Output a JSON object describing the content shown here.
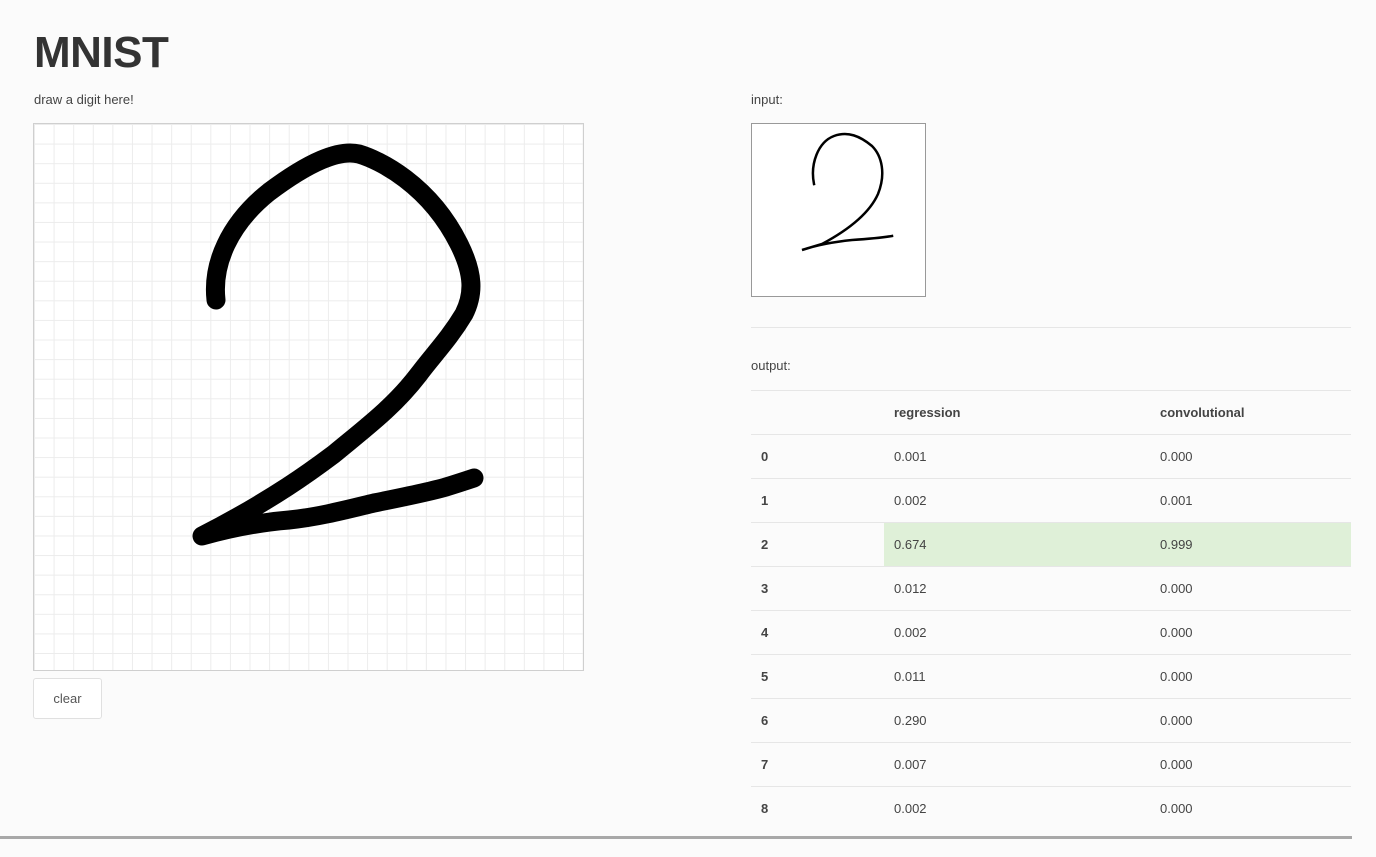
{
  "page": {
    "title": "MNIST",
    "draw_label": "draw a digit here!",
    "clear_label": "clear",
    "input_label": "input:",
    "output_label": "output:"
  },
  "table": {
    "headers": [
      "",
      "regression",
      "convolutional"
    ],
    "rows": [
      {
        "digit": "0",
        "regression": "0.001",
        "convolutional": "0.000"
      },
      {
        "digit": "1",
        "regression": "0.002",
        "convolutional": "0.001"
      },
      {
        "digit": "2",
        "regression": "0.674",
        "convolutional": "0.999",
        "highlighted": true
      },
      {
        "digit": "3",
        "regression": "0.012",
        "convolutional": "0.000"
      },
      {
        "digit": "4",
        "regression": "0.002",
        "convolutional": "0.000"
      },
      {
        "digit": "5",
        "regression": "0.011",
        "convolutional": "0.000"
      },
      {
        "digit": "6",
        "regression": "0.290",
        "convolutional": "0.000"
      },
      {
        "digit": "7",
        "regression": "0.007",
        "convolutional": "0.000"
      },
      {
        "digit": "8",
        "regression": "0.002",
        "convolutional": "0.000"
      }
    ]
  },
  "colors": {
    "highlight": "#dff0d8",
    "stroke": "#000000"
  }
}
